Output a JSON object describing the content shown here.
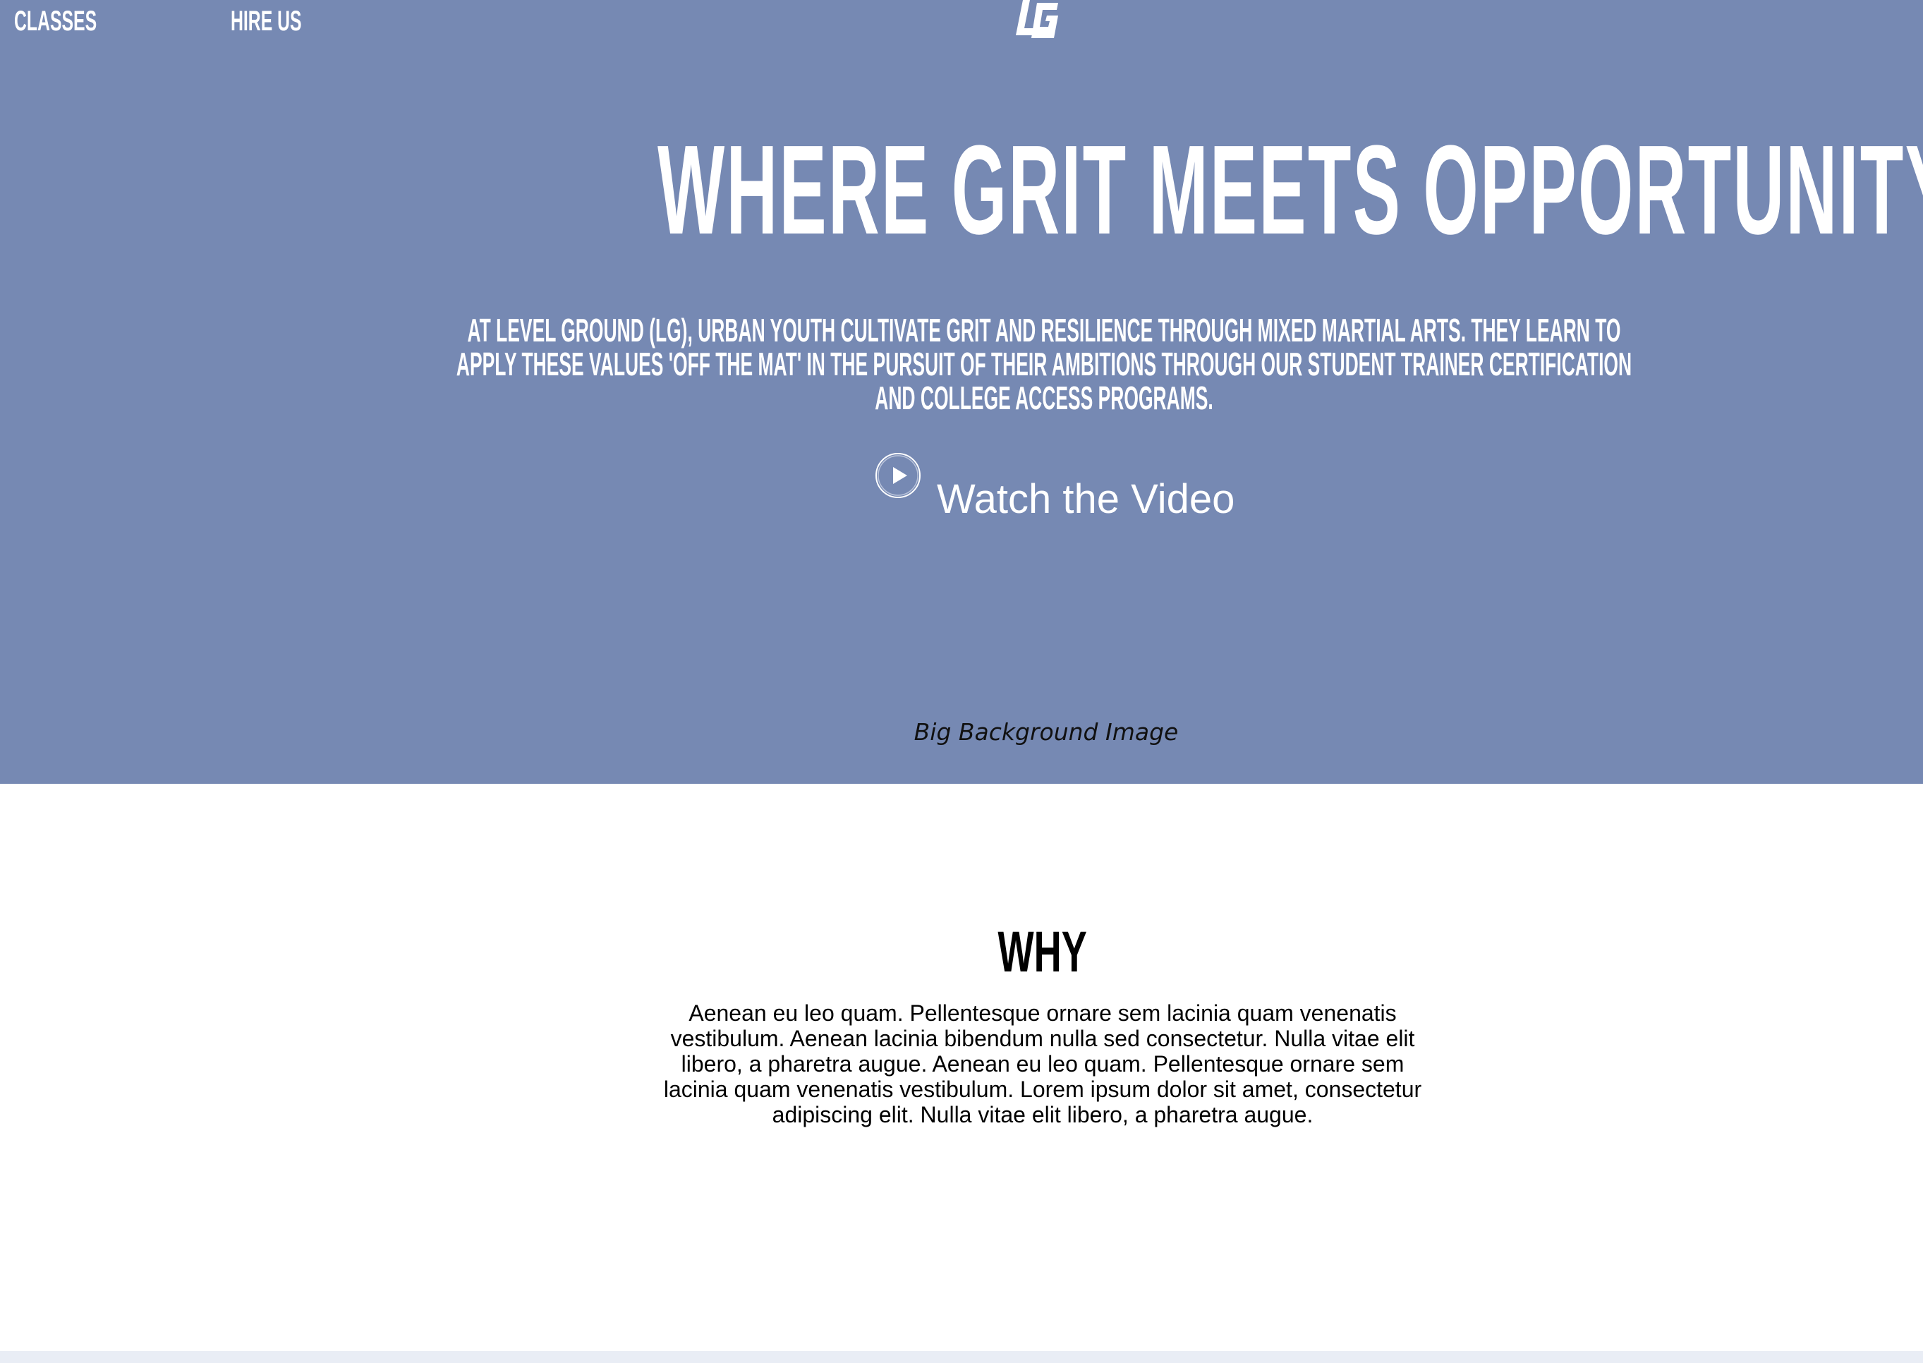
{
  "nav": {
    "classes_label": "CLASSES",
    "hire_label": "HIRE US"
  },
  "logo": {
    "icon": "lg-logo-icon",
    "text": "LG"
  },
  "hero": {
    "headline": "WHERE GRIT MEETS OPPORTUNITY",
    "intro": "AT LEVEL GROUND (LG), URBAN YOUTH CULTIVATE GRIT AND RESILIENCE THROUGH MIXED MARTIAL ARTS. THEY LEARN TO APPLY THESE VALUES 'OFF THE MAT' IN THE PURSUIT OF THEIR AMBITIONS THROUGH OUR STUDENT TRAINER CERTIFICATION AND COLLEGE ACCESS PROGRAMS.",
    "watch_label": "Watch the Video",
    "play_icon": "play-circle-icon",
    "background_caption": "Big Background Image",
    "background_color": "#7689b3"
  },
  "why": {
    "title": "WHY",
    "body": "Aenean eu leo quam. Pellentesque ornare sem lacinia quam venenatis vestibulum. Aenean lacinia bibendum nulla sed consectetur. Nulla vitae elit libero, a pharetra augue. Aenean eu leo quam. Pellentesque ornare sem lacinia quam venenatis vestibulum. Lorem ipsum dolor sit amet, consectetur adipiscing elit. Nulla vitae elit libero, a pharetra augue."
  }
}
